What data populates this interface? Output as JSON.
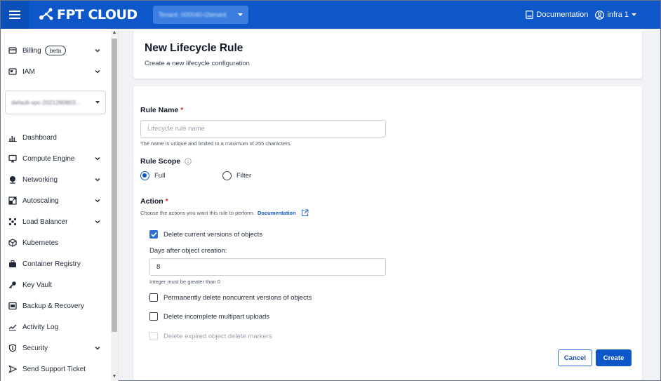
{
  "header": {
    "brand": "FPT CLOUD",
    "tenant": "Tenant: 000040-i2tenant",
    "documentation": "Documentation",
    "user": "infra 1"
  },
  "sidebar": {
    "billing": "Billing",
    "billing_badge": "beta",
    "iam": "IAM",
    "vpc_select": "default-vpc-2021280803...",
    "items": [
      {
        "label": "Dashboard",
        "icon": "bar-chart-icon"
      },
      {
        "label": "Compute Engine",
        "icon": "monitor-icon"
      },
      {
        "label": "Networking",
        "icon": "globe-icon"
      },
      {
        "label": "Autoscaling",
        "icon": "autoscaling-icon"
      },
      {
        "label": "Load Balancer",
        "icon": "load-balancer-icon"
      },
      {
        "label": "Kubernetes",
        "icon": "cube-icon"
      },
      {
        "label": "Container Registry",
        "icon": "container-icon"
      },
      {
        "label": "Key Vault",
        "icon": "key-icon"
      },
      {
        "label": "Backup & Recovery",
        "icon": "backup-icon"
      },
      {
        "label": "Activity Log",
        "icon": "activity-icon"
      },
      {
        "label": "Security",
        "icon": "shield-icon"
      },
      {
        "label": "Send Support Ticket",
        "icon": "send-icon"
      }
    ]
  },
  "page": {
    "title": "New Lifecycle Rule",
    "subtitle": "Create a new lifecycle configuration"
  },
  "form": {
    "rule_name_label": "Rule Name",
    "required_mark": "*",
    "rule_name_placeholder": "Lifecycle rule name",
    "rule_name_value": "",
    "rule_name_hint": "The name is unique and limited to a maximum of 255 characters.",
    "rule_scope_label": "Rule Scope",
    "scope_full": "Full",
    "scope_filter": "Filter",
    "action_label": "Action",
    "action_hint": "Choose the actions you want this rule to perform.",
    "action_doc_link": "Documentation",
    "opt_delete_current": "Delete current versions of objects",
    "days_label": "Days after object creation:",
    "days_value": "8",
    "days_hint": "Integer must be greater than 0",
    "opt_perm_delete": "Permanently delete noncurrent versions of objects",
    "opt_incomplete": "Delete incomplete multipart uploads",
    "opt_expired_markers": "Delete expired object delete markers",
    "cancel": "Cancel",
    "create": "Create"
  },
  "colors": {
    "primary": "#0d57c9",
    "required": "#dc2626"
  }
}
